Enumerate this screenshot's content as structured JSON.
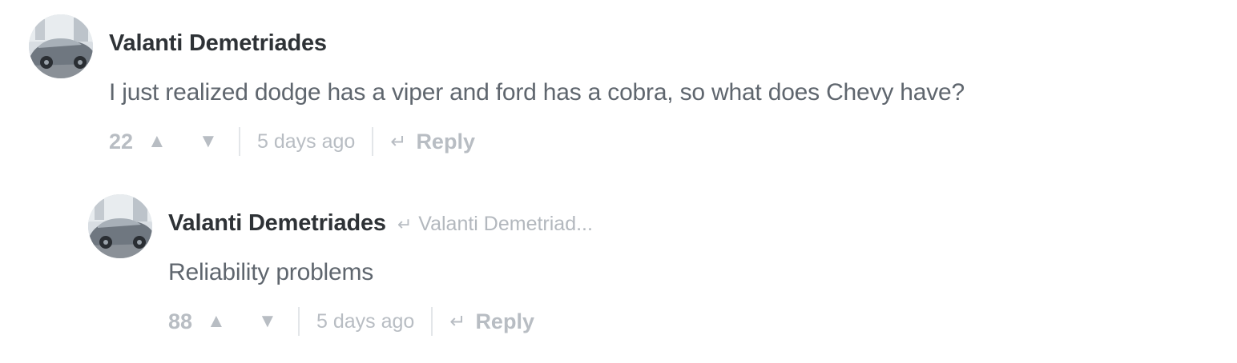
{
  "comments": [
    {
      "author": "Valanti Demetriades",
      "reply_to": "",
      "text": "I just realized dodge has a viper and ford has a cobra, so what does Chevy have?",
      "votes": "22",
      "time": "5 days ago",
      "reply_label": "Reply"
    },
    {
      "author": "Valanti Demetriades",
      "reply_to": "Valanti Demetriad...",
      "text": "Reliability problems",
      "votes": "88",
      "time": "5 days ago",
      "reply_label": "Reply"
    }
  ],
  "icons": {
    "upvote": "▲",
    "downvote": "▼",
    "reply": "↵"
  },
  "colors": {
    "author": "#2e3236",
    "text": "#5f666e",
    "muted": "#b8bdc3",
    "separator": "#e3e6e9"
  }
}
